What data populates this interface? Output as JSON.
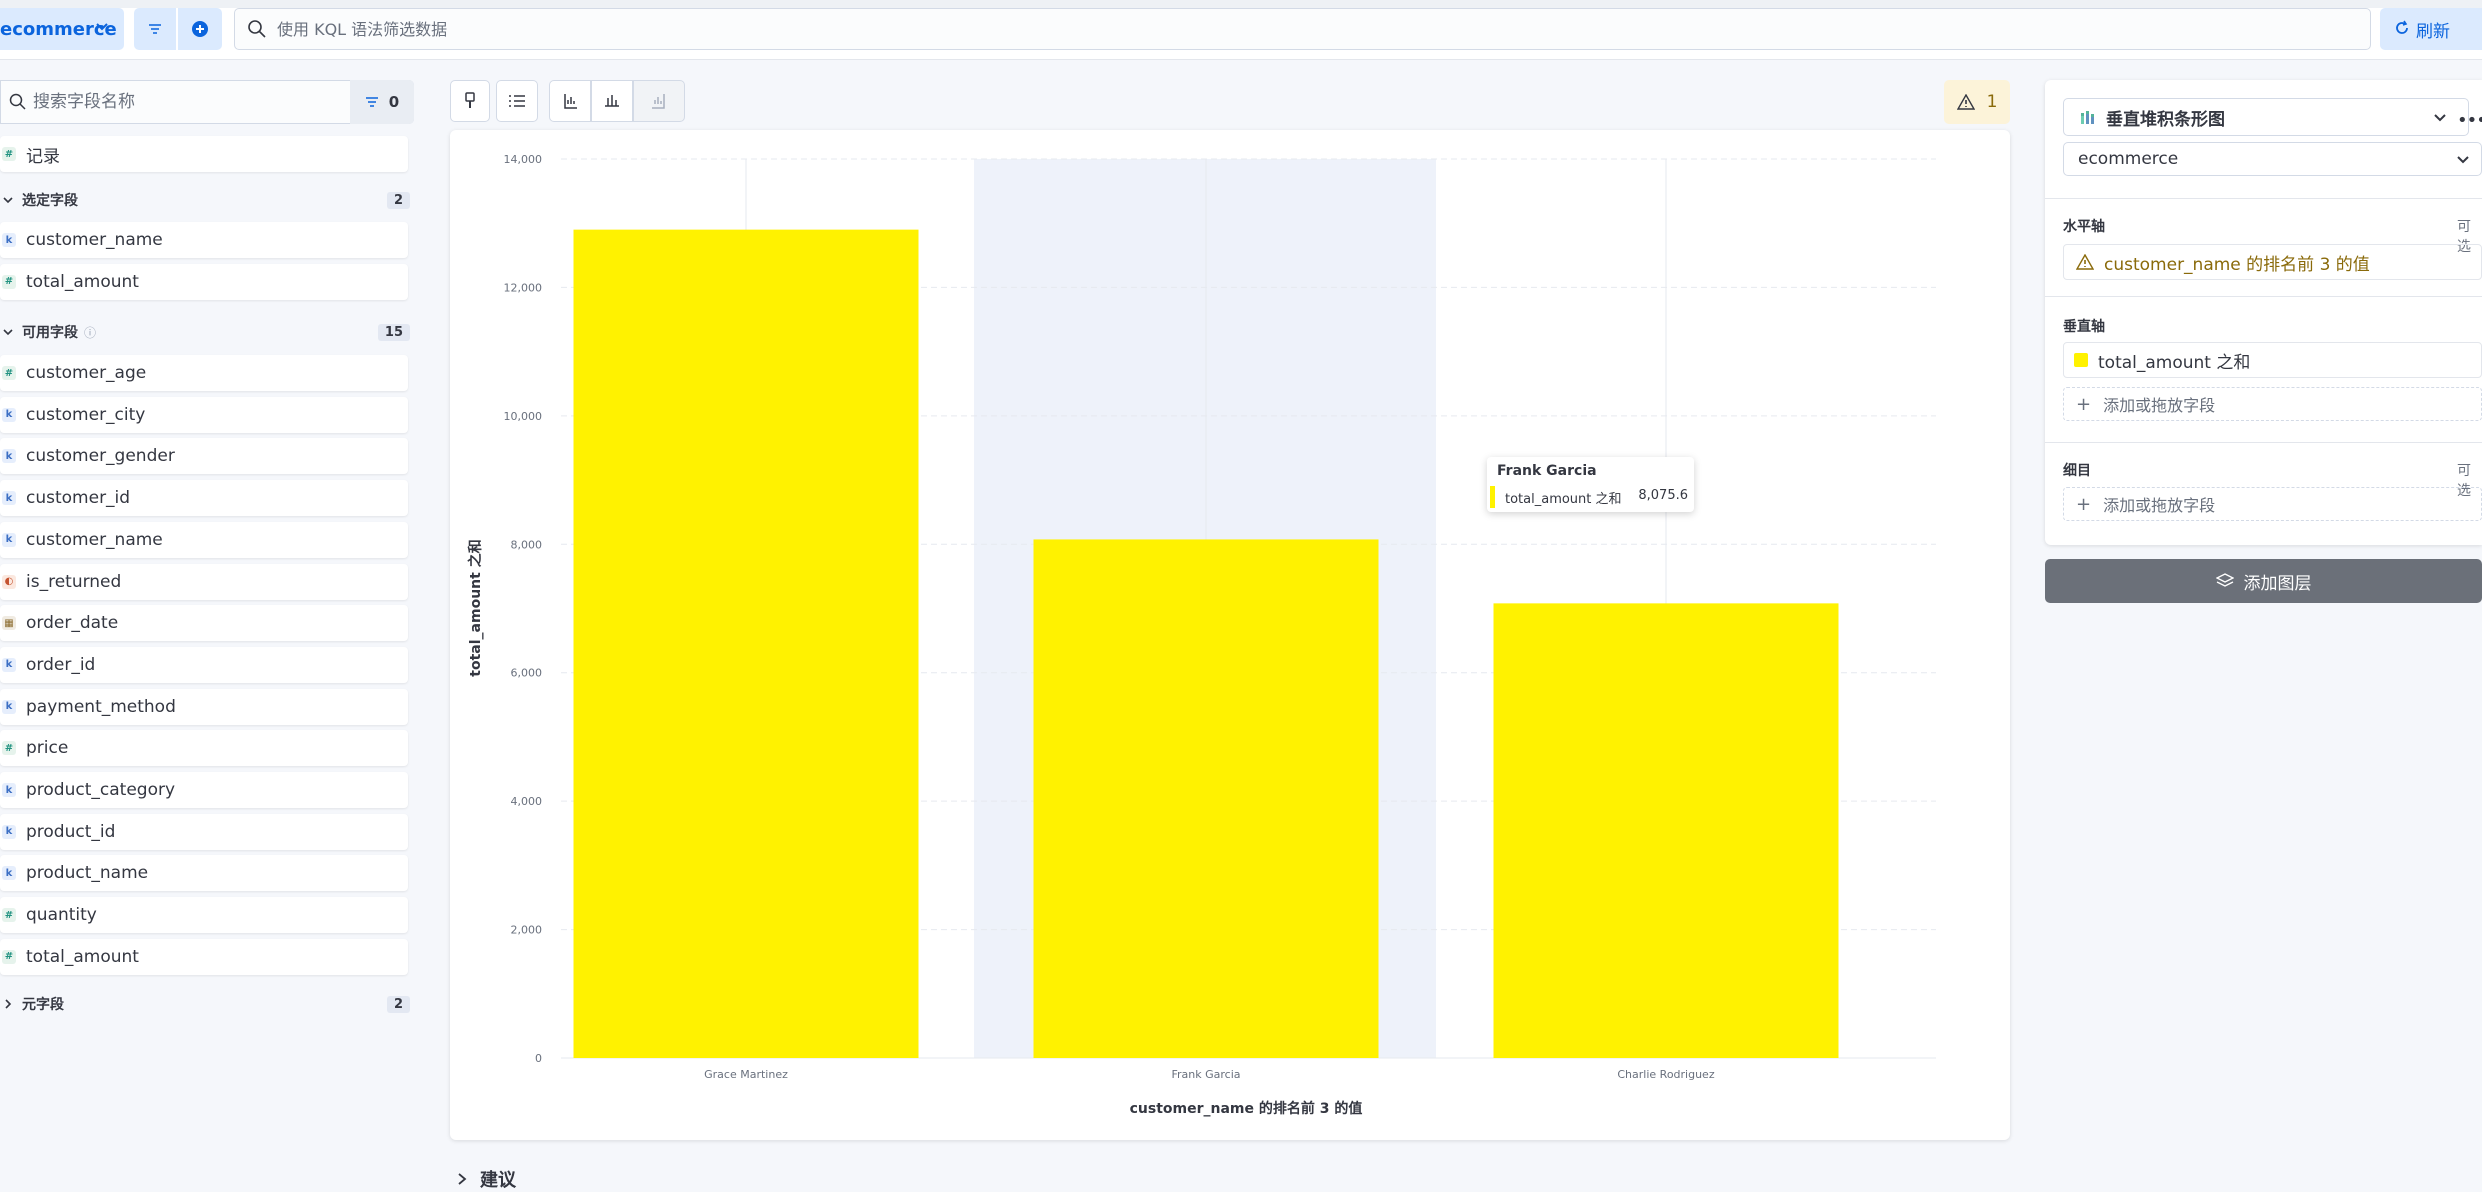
{
  "topbar": {
    "data_view": "ecommerce",
    "kql_placeholder": "使用 KQL 语法筛选数据",
    "refresh_label": "刷新"
  },
  "sidebar": {
    "search_placeholder": "搜索字段名称",
    "filter_count": "0",
    "records_field": {
      "type": "#",
      "name": "记录"
    },
    "selected": {
      "title": "选定字段",
      "count": "2",
      "fields": [
        {
          "type": "k",
          "name": "customer_name"
        },
        {
          "type": "#",
          "name": "total_amount"
        }
      ]
    },
    "available": {
      "title": "可用字段",
      "count": "15",
      "fields": [
        {
          "type": "#",
          "name": "customer_age"
        },
        {
          "type": "k",
          "name": "customer_city"
        },
        {
          "type": "k",
          "name": "customer_gender"
        },
        {
          "type": "k",
          "name": "customer_id"
        },
        {
          "type": "k",
          "name": "customer_name"
        },
        {
          "type": "bool",
          "name": "is_returned"
        },
        {
          "type": "date",
          "name": "order_date"
        },
        {
          "type": "k",
          "name": "order_id"
        },
        {
          "type": "k",
          "name": "payment_method"
        },
        {
          "type": "#",
          "name": "price"
        },
        {
          "type": "k",
          "name": "product_category"
        },
        {
          "type": "k",
          "name": "product_id"
        },
        {
          "type": "k",
          "name": "product_name"
        },
        {
          "type": "#",
          "name": "quantity"
        },
        {
          "type": "#",
          "name": "total_amount"
        }
      ]
    },
    "meta": {
      "title": "元字段",
      "count": "2"
    }
  },
  "toolbar": {
    "warning_count": "1"
  },
  "chart_data": {
    "type": "bar",
    "categories": [
      "Grace Martinez",
      "Frank Garcia",
      "Charlie Rodriguez"
    ],
    "values": [
      12900,
      8075.6,
      7080
    ],
    "xlabel": "customer_name 的排名前 3 的值",
    "ylabel": "total_amount 之和",
    "ylim": [
      0,
      14000
    ],
    "yticks": [
      "0",
      "2,000",
      "4,000",
      "6,000",
      "8,000",
      "10,000",
      "12,000",
      "14,000"
    ],
    "highlighted_category": "Frank Garcia",
    "bar_color": "#fff200",
    "grid": true
  },
  "tooltip": {
    "title": "Frank Garcia",
    "series": "total_amount 之和",
    "value": "8,075.6"
  },
  "suggestions_label": "建议",
  "config": {
    "chart_type": "垂直堆积条形图",
    "data_view": "ecommerce",
    "horizontal_axis": {
      "label": "水平轴",
      "optional": "可选",
      "value": "customer_name 的排名前 3 的值"
    },
    "vertical_axis": {
      "label": "垂直轴",
      "value": "total_amount 之和",
      "add": "添加或拖放字段"
    },
    "breakdown": {
      "label": "细目",
      "optional": "可选",
      "add": "添加或拖放字段"
    },
    "add_layer": "添加图层"
  }
}
